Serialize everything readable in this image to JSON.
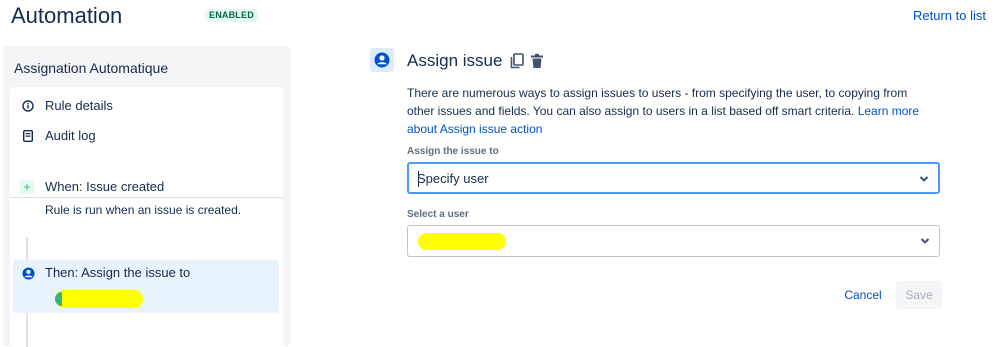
{
  "header": {
    "title": "Automation",
    "status": "ENABLED",
    "return_link": "Return to list"
  },
  "sidebar": {
    "rule_name": "Assignation Automatique",
    "links": [
      {
        "label": "Rule details",
        "icon": "info-icon"
      },
      {
        "label": "Audit log",
        "icon": "document-icon"
      }
    ],
    "trigger": {
      "title": "When: Issue created",
      "description": "Rule is run when an issue is created.",
      "icon": "plus-icon"
    },
    "action": {
      "title": "Then: Assign the issue to",
      "icon": "user-circle-icon"
    }
  },
  "panel": {
    "title": "Assign issue",
    "description": "There are numerous ways to assign issues to users - from specifying the user, to copying from other issues and fields. You can also assign to users in a list based off smart criteria. ",
    "learn_more": "Learn more about Assign issue action",
    "assign_label": "Assign the issue to",
    "assign_value": "Specify user",
    "user_label": "Select a user",
    "user_value": "",
    "cancel_label": "Cancel",
    "save_label": "Save"
  },
  "colors": {
    "link": "#0052cc",
    "enabled_bg": "#e3fcef",
    "enabled_text": "#006644",
    "selected_bg": "#e9f2ff",
    "focus_border": "#4c9aff",
    "redaction": "#ffff00"
  }
}
